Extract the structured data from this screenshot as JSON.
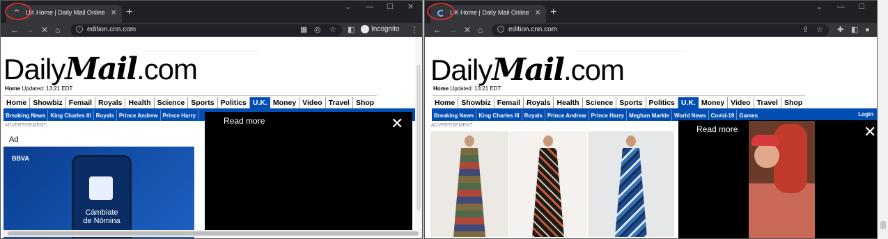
{
  "windows": [
    {
      "tab_title": "UK Home | Daily Mail Online",
      "url": "edition.cnn.com",
      "incognito_label": "Incognito",
      "page": {
        "logo": {
          "part1": "Daily",
          "part2": "Mail",
          "part3": ".com"
        },
        "updated_label": "Home",
        "updated_text": "Updated: 13:21 EDT",
        "nav": [
          "Home",
          "Showbiz",
          "Femail",
          "Royals",
          "Health",
          "Science",
          "Sports",
          "Politics",
          "U.K.",
          "Money",
          "Video",
          "Travel",
          "Shop"
        ],
        "subnav": [
          "Breaking News",
          "King Charles III",
          "Royals",
          "Prince Andrew",
          "Prince Harry"
        ],
        "advertisement_label": "ADVERTISEMENT",
        "ad_label": "Ad",
        "ad": {
          "brand": "BBVA",
          "headline": "Cámbiate de Nómina"
        },
        "overlay": {
          "read_more": "Read more",
          "close": "✕"
        }
      }
    },
    {
      "tab_title": "UK Home | Daily Mail Online",
      "url": "edition.cnn.com",
      "page": {
        "logo": {
          "part1": "Daily",
          "part2": "Mail",
          "part3": ".com"
        },
        "updated_label": "Home",
        "updated_text": "Updated: 13:21 EDT",
        "nav": [
          "Home",
          "Showbiz",
          "Femail",
          "Royals",
          "Health",
          "Science",
          "Sports",
          "Politics",
          "U.K.",
          "Money",
          "Video",
          "Travel",
          "Shop"
        ],
        "subnav": [
          "Breaking News",
          "King Charles III",
          "Royals",
          "Prince Andrew",
          "Prince Harry",
          "Meghan Markle",
          "World News",
          "Covid-19",
          "Games"
        ],
        "login": "Login",
        "advertisement_label": "ADVERTISEMENT",
        "overlay": {
          "read_more": "Read more",
          "close": "✕"
        }
      }
    }
  ],
  "colors": {
    "chrome_dark": "#202124",
    "chrome_tab": "#35363a",
    "dm_blue": "#004db3",
    "highlight_red": "#d32f2f"
  },
  "icons": [
    "back-arrow-icon",
    "forward-arrow-icon",
    "stop-icon",
    "home-icon",
    "lock-icon",
    "qr-icon",
    "eye-off-icon",
    "star-icon",
    "sidebar-icon",
    "menu-icon",
    "share-icon",
    "extensions-icon",
    "profile-icon",
    "close-icon"
  ]
}
